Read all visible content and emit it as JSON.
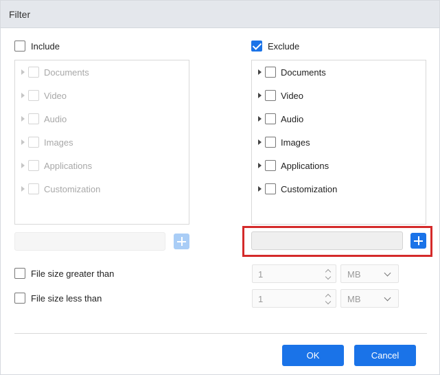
{
  "window": {
    "title": "Filter"
  },
  "include": {
    "label": "Include",
    "checked": false,
    "categories": [
      {
        "label": "Documents"
      },
      {
        "label": "Video"
      },
      {
        "label": "Audio"
      },
      {
        "label": "Images"
      },
      {
        "label": "Applications"
      },
      {
        "label": "Customization"
      }
    ]
  },
  "exclude": {
    "label": "Exclude",
    "checked": true,
    "categories": [
      {
        "label": "Documents"
      },
      {
        "label": "Video"
      },
      {
        "label": "Audio"
      },
      {
        "label": "Images"
      },
      {
        "label": "Applications"
      },
      {
        "label": "Customization"
      }
    ]
  },
  "size_filters": {
    "greater": {
      "label": "File size greater than",
      "value": "1",
      "unit": "MB"
    },
    "less": {
      "label": "File size less than",
      "value": "1",
      "unit": "MB"
    }
  },
  "buttons": {
    "ok": "OK",
    "cancel": "Cancel"
  },
  "colors": {
    "accent": "#1a73e8",
    "highlight": "#d42a2a"
  }
}
